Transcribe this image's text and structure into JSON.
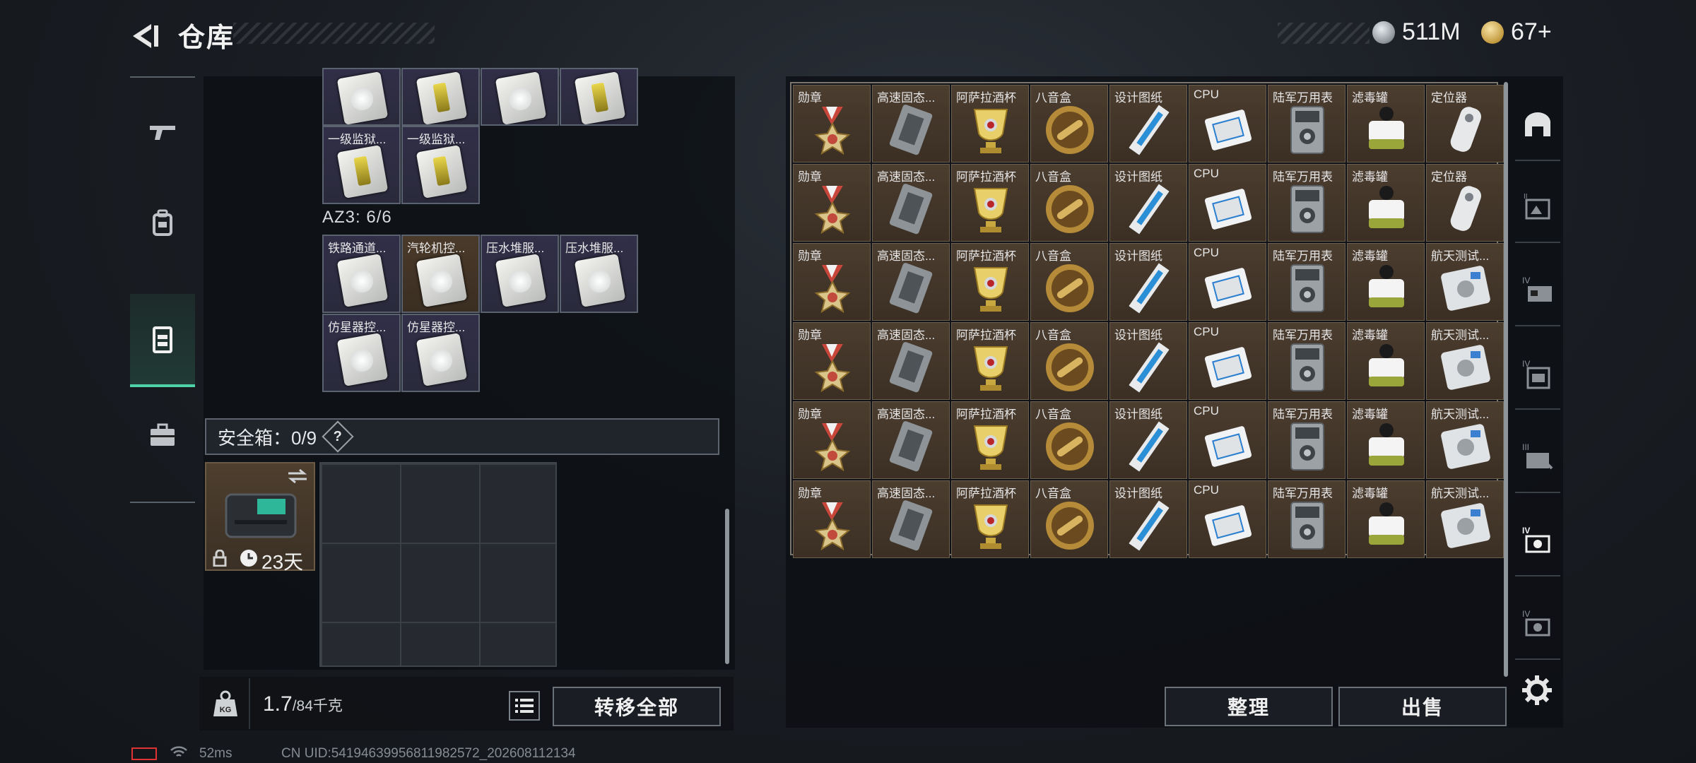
{
  "header": {
    "title": "仓库",
    "currency_silver": "511M",
    "currency_gold": "67+"
  },
  "left_tabs": [
    "gun-icon",
    "backpack-icon",
    "rig-icon",
    "briefcase-icon"
  ],
  "inventory": {
    "top_row_partial": [
      {
        "label": "",
        "style": "purple",
        "art": "bag-white"
      },
      {
        "label": "",
        "style": "purple",
        "art": "bag-yellow"
      },
      {
        "label": "",
        "style": "purple",
        "art": "bag-white"
      },
      {
        "label": "",
        "style": "purple",
        "art": "bag-yellow"
      }
    ],
    "row2": [
      {
        "label": "一级监狱...",
        "style": "purple",
        "art": "bag-yellow"
      },
      {
        "label": "一级监狱...",
        "style": "purple",
        "art": "bag-yellow"
      }
    ],
    "az3_label": "AZ3: 6/6",
    "az3_row1": [
      {
        "label": "铁路通道...",
        "style": "purple",
        "art": "bag-white"
      },
      {
        "label": "汽轮机控...",
        "style": "brown",
        "art": "bag-white"
      },
      {
        "label": "压水堆服...",
        "style": "purple",
        "art": "bag-white"
      },
      {
        "label": "压水堆服...",
        "style": "purple",
        "art": "bag-white"
      }
    ],
    "az3_row2": [
      {
        "label": "仿星器控...",
        "style": "purple",
        "art": "bag-white"
      },
      {
        "label": "仿星器控...",
        "style": "purple",
        "art": "bag-white"
      }
    ]
  },
  "safe_box": {
    "label": "安全箱：0/9",
    "help": "?",
    "timer": "23天"
  },
  "weight": {
    "current": "1.7",
    "capacity": "/84千克"
  },
  "buttons": {
    "transfer_all": "转移全部",
    "organize": "整理",
    "sell": "出售"
  },
  "stash_columns": [
    {
      "label": "勋章",
      "art": "medal"
    },
    {
      "label": "高速固态...",
      "art": "ssd"
    },
    {
      "label": "阿萨拉酒杯",
      "art": "cup"
    },
    {
      "label": "八音盒",
      "art": "musicbox"
    },
    {
      "label": "设计图纸",
      "art": "blueprint"
    },
    {
      "label": "CPU",
      "art": "cpu"
    },
    {
      "label": "陆军万用表",
      "art": "multimeter"
    },
    {
      "label": "滤毒罐",
      "art": "filter"
    },
    {
      "label": "定位器",
      "art": "locator"
    }
  ],
  "stash_last_column_rows": [
    "定位器",
    "定位器",
    "航天测试...",
    "航天测试...",
    "航天测试...",
    "航天测试..."
  ],
  "right_tabs": [
    "vault-icon",
    "display-case-icon",
    "shelf-iv-icon",
    "shelf-iv-2-icon",
    "shelf-iii-icon",
    "shelf-iv-3-icon",
    "shelf-iv-4-icon",
    "settings-icon"
  ],
  "status": {
    "ping": "52ms",
    "uid": "CN UID:541946399568119825​72_202608112134"
  },
  "colors": {
    "accent": "#4fd2a8",
    "item_brown": "#4b3d2f",
    "item_purple": "#312f48"
  }
}
